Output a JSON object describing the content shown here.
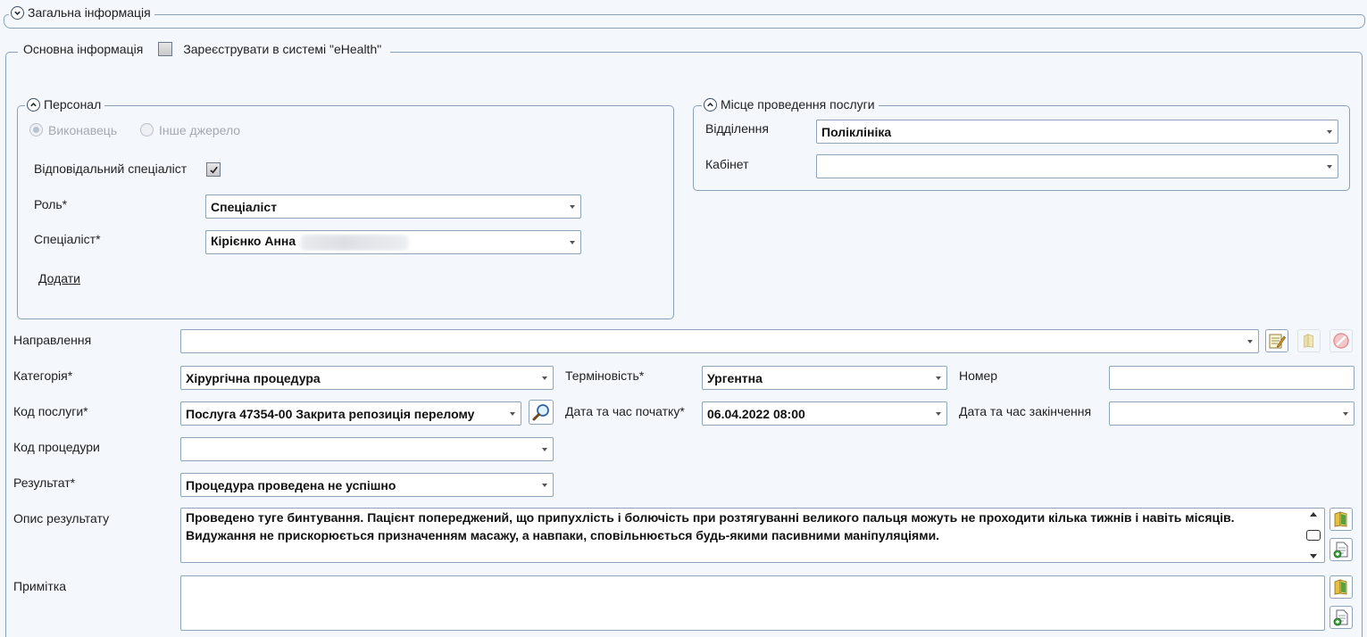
{
  "sections": {
    "general_info": "Загальна інформація",
    "basic_info": "Основна інформація",
    "register_ehealth": "Зареєструвати в системі \"eHealth\"",
    "register_ehealth_checked": false
  },
  "personnel": {
    "title": "Персонал",
    "radio_executor": "Виконавець",
    "radio_other_source": "Інше джерело",
    "responsible_label": "Відповідальний спеціаліст",
    "responsible_checked": true,
    "role_label": "Роль*",
    "role_value": "Спеціаліст",
    "specialist_label": "Спеціаліст*",
    "specialist_value": "Кірієнко Анна",
    "add_link": "Додати"
  },
  "place": {
    "title": "Місце проведення послуги",
    "department_label": "Відділення",
    "department_value": "Поліклініка",
    "cabinet_label": "Кабінет",
    "cabinet_value": ""
  },
  "form": {
    "referral_label": "Направлення",
    "referral_value": "",
    "category_label": "Категорія*",
    "category_value": "Хірургічна процедура",
    "urgency_label": "Терміновість*",
    "urgency_value": "Ургентна",
    "number_label": "Номер",
    "number_value": "",
    "service_code_label": "Код послуги*",
    "service_code_value": "Послуга 47354-00 Закрита репозиція перелому",
    "start_label": "Дата та час початку*",
    "start_value": "06.04.2022 08:00",
    "end_label": "Дата та час закінчення",
    "end_value": "",
    "procedure_code_label": "Код процедури",
    "procedure_code_value": "",
    "result_label": "Результат*",
    "result_value": "Процедура проведена не успішно",
    "result_desc_label": "Опис результату",
    "result_desc_value": "Проведено туге бинтування. Пацієнт попереджений, що припухлість і болючість при розтягуванні великого пальця можуть не проходити кілька тижнів і навіть місяців. Видужання не прискорюється призначенням масажу, а навпаки, сповільнюється будь-якими пасивними маніпуляціями.",
    "note_label": "Примітка",
    "note_value": ""
  },
  "icons": {
    "expand": "chevron-down-icon",
    "collapse": "chevron-up-icon",
    "edit_referral": "edit-note-icon",
    "open_referral": "book-icon",
    "clear_referral": "cancel-icon",
    "search_service": "magnifier-icon",
    "templates": "book-icon",
    "insert_template": "add-document-icon"
  }
}
